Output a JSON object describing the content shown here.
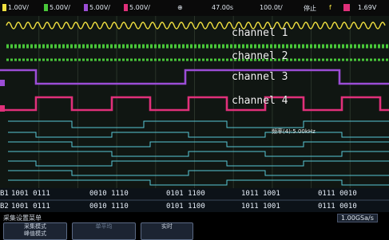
{
  "status_bar": {
    "ch1_scale": "1.00V/",
    "ch2_scale": "5.00V/",
    "ch3_scale": "5.00V/",
    "ch4_scale": "5.00V/",
    "trigger_icon": "trigger-icon",
    "time_offset": "47.00s",
    "time_scale": "100.0t/",
    "run_state": "停止",
    "trigger_slope": "f",
    "trigger_level": "1.69V",
    "ch1_color": "#f0e040",
    "ch2_color": "#49c83a",
    "ch3_color": "#9b4dd6",
    "ch4_color": "#e0307a"
  },
  "waveform": {
    "channel_labels": [
      "channel 1",
      "channel 2",
      "channel 3",
      "channel 4"
    ],
    "frequency_readout": "频率(4):5.00kHz",
    "bus_labels": [
      "B1",
      "B2"
    ],
    "bus_rows": [
      [
        "1001  0111",
        "0010  1110",
        "0101  1100",
        "1011  1001",
        "0111  0010"
      ],
      [
        "1001  0111",
        "0010  1110",
        "0101  1100",
        "1011  1001",
        "0111  0010"
      ]
    ]
  },
  "bottom_menu": {
    "title": "采集设置菜单",
    "sample_rate": "1.00GSa/s",
    "softkeys": [
      {
        "line1": "采集模式",
        "line2": "峰值模式"
      },
      {
        "line1": "单平均",
        "line2": ""
      },
      {
        "line1": "实时",
        "line2": ""
      }
    ]
  }
}
